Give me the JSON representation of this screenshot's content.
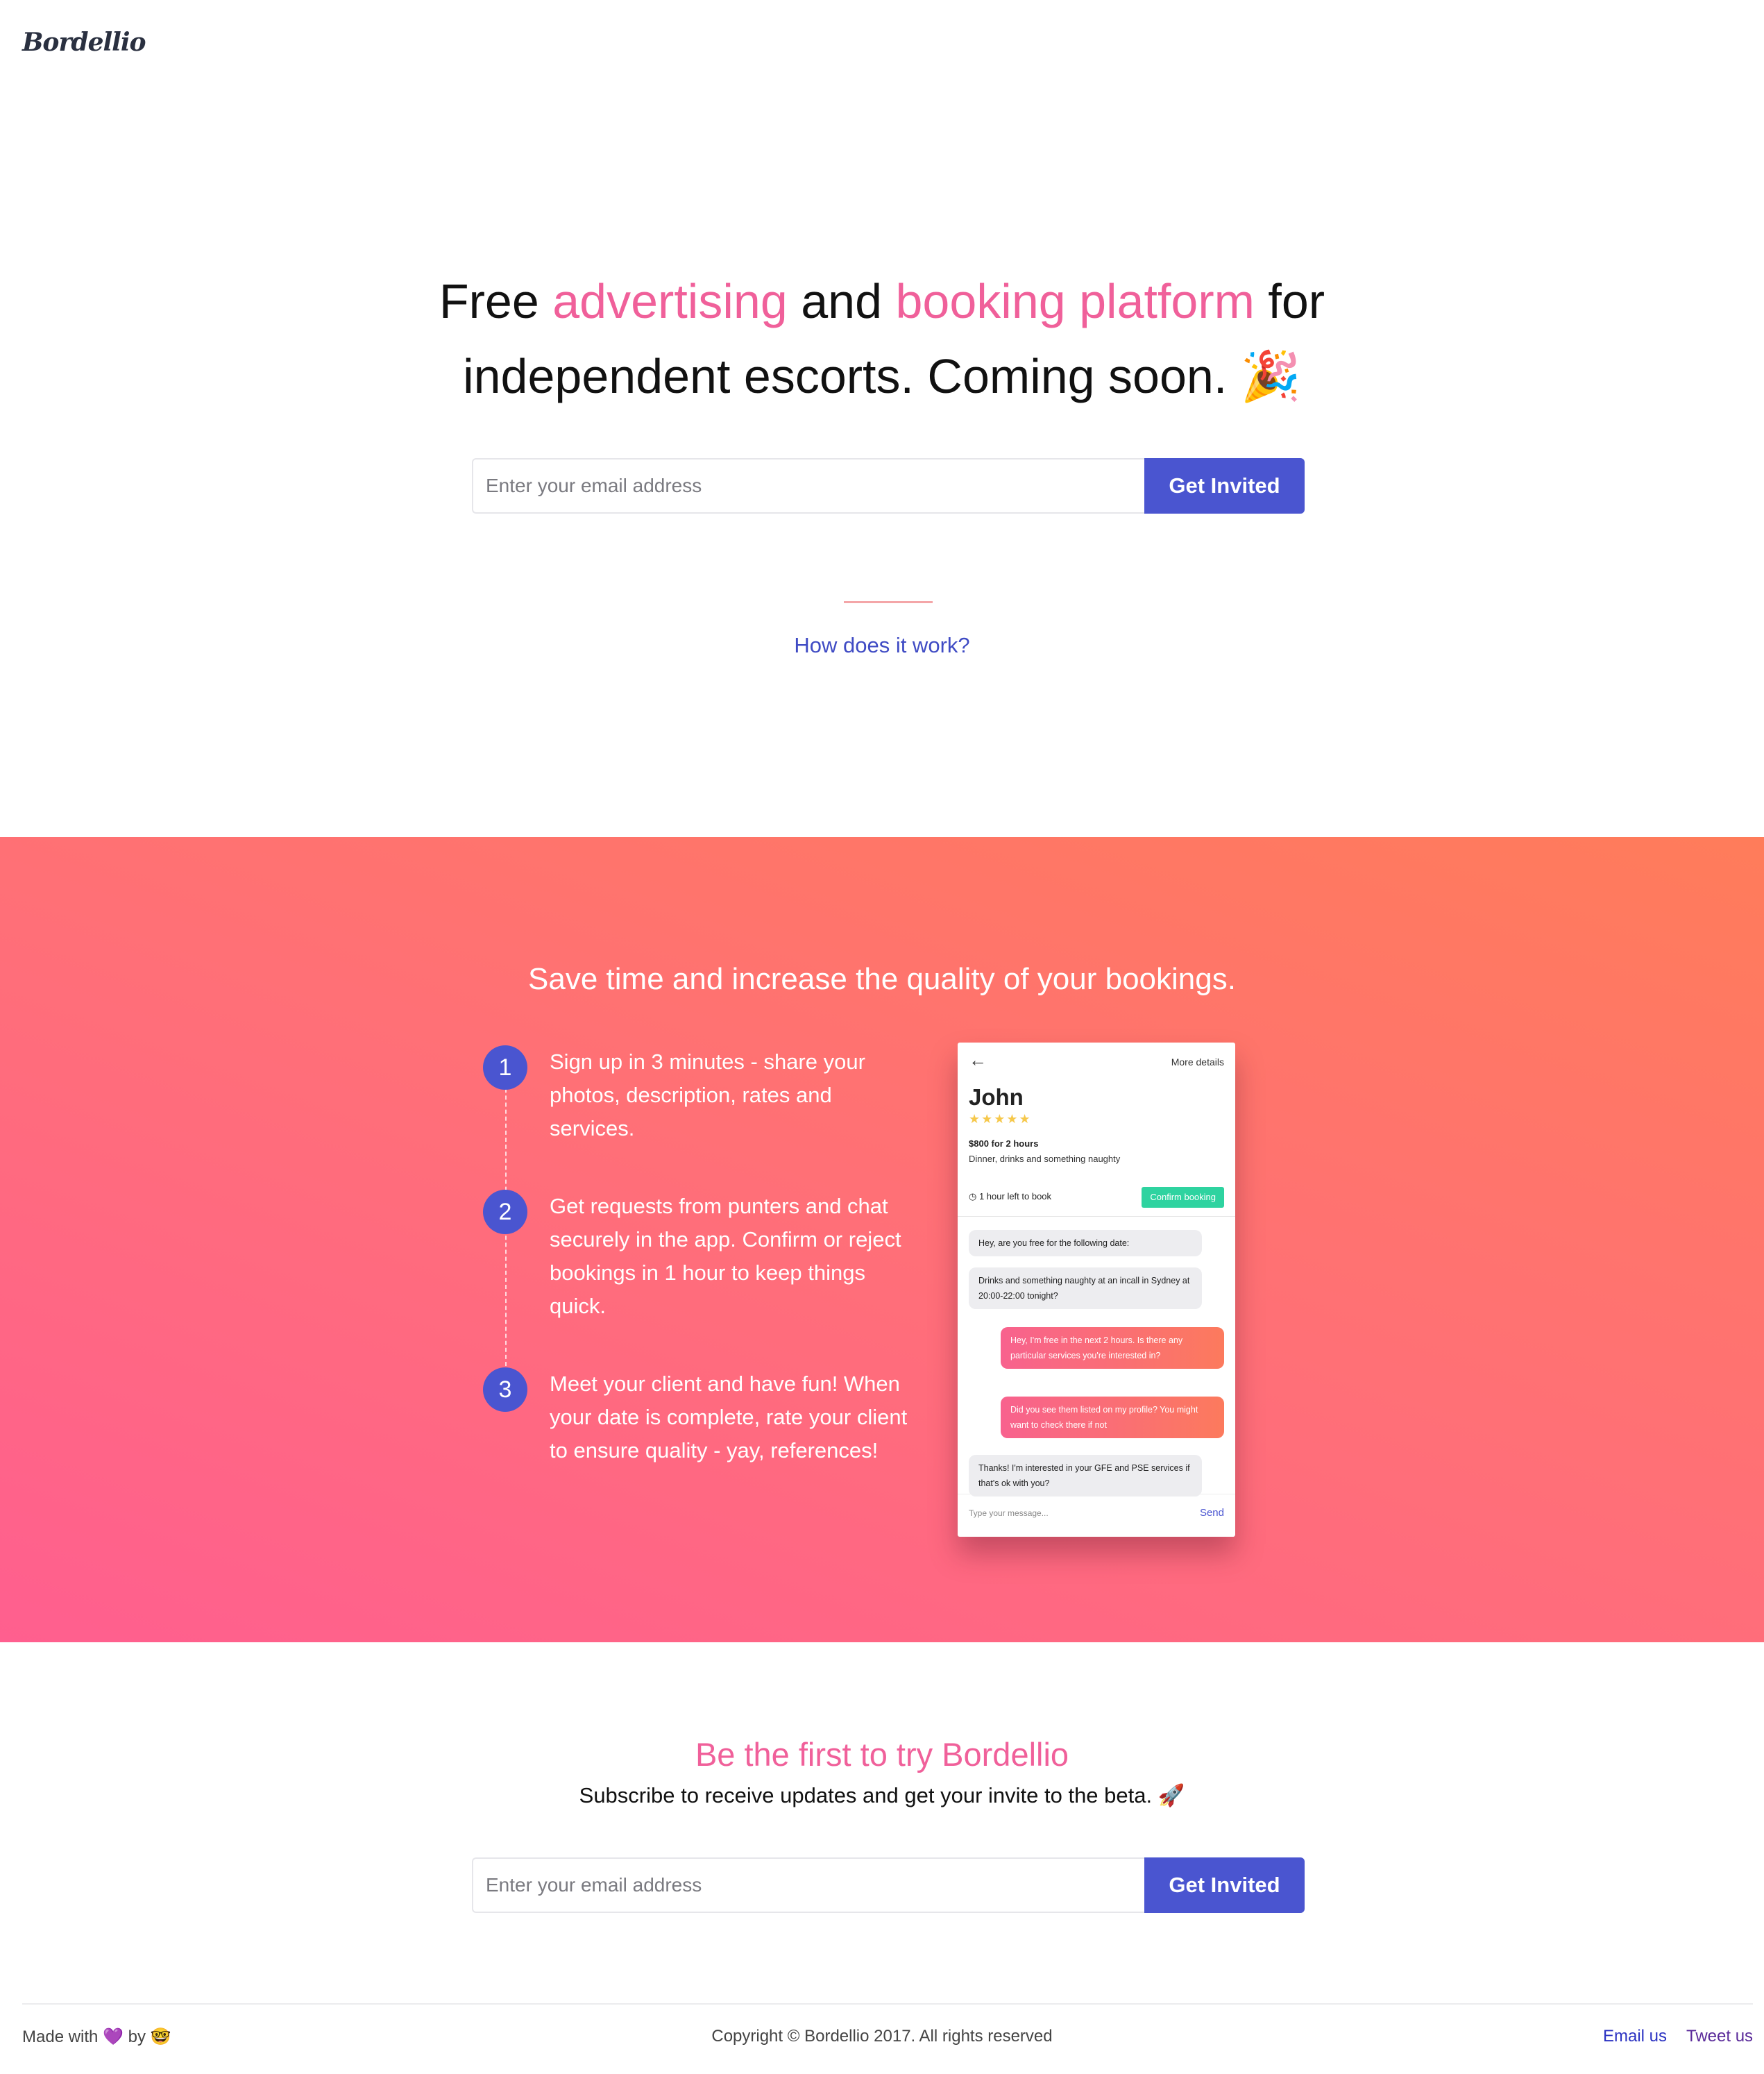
{
  "brand": {
    "logo": "Bordellio",
    "accent": "#f0609a",
    "primary": "#4a55d0"
  },
  "hero": {
    "title_part1": "Free ",
    "title_highlight1": "advertising",
    "title_part2": " and ",
    "title_highlight2": "booking platform",
    "title_part3": " for",
    "title_line2": "independent escorts. Coming soon.",
    "title_emoji": "🎉",
    "email_placeholder": "Enter your email address",
    "button_label": "Get Invited",
    "how_link": "How does it work?"
  },
  "features": {
    "heading": "Save time and increase the quality of your bookings.",
    "steps": [
      {
        "number": "1",
        "text": "Sign up in 3 minutes - share your photos, description, rates and services."
      },
      {
        "number": "2",
        "text": "Get requests from punters and chat securely in the app. Confirm or reject bookings in 1 hour to keep things quick."
      },
      {
        "number": "3",
        "text": "Meet your client and have fun! When your date is complete, rate your client to ensure quality - yay, references!"
      }
    ]
  },
  "phone": {
    "back_icon": "arrow-left-icon",
    "more": "More details",
    "name": "John",
    "stars": "★★★★★",
    "price": "$800 for 2 hours",
    "description": "Dinner, drinks and something naughty",
    "timer_icon": "clock-icon",
    "timer": "1 hour left to book",
    "confirm": "Confirm booking",
    "messages": [
      {
        "from": "client",
        "text": "Hey, are you free for the following date:"
      },
      {
        "from": "client",
        "text": "Drinks and something naughty at an incall in Sydney at 20:00-22:00 tonight?"
      },
      {
        "from": "me",
        "text": "Hey, I'm free in the next 2 hours. Is there any particular services you're interested in?"
      },
      {
        "from": "me",
        "text": "Did you see them listed on my profile? You might want to check there if not"
      },
      {
        "from": "client",
        "text": "Thanks! I'm interested in your GFE and PSE services if that's ok with you?"
      }
    ],
    "compose_placeholder": "Type your message...",
    "send": "Send"
  },
  "cta": {
    "title": "Be the first to try Bordellio",
    "subtitle": "Subscribe to receive updates and get your invite to the beta.",
    "subtitle_emoji": "🚀",
    "email_placeholder": "Enter your email address",
    "button_label": "Get Invited"
  },
  "footer": {
    "made_with": "Made with",
    "heart": "💜",
    "by": "by",
    "face": "🤓",
    "copyright": "Copyright © Bordellio 2017. All rights reserved",
    "email_link": "Email us",
    "tweet_link": "Tweet us"
  }
}
